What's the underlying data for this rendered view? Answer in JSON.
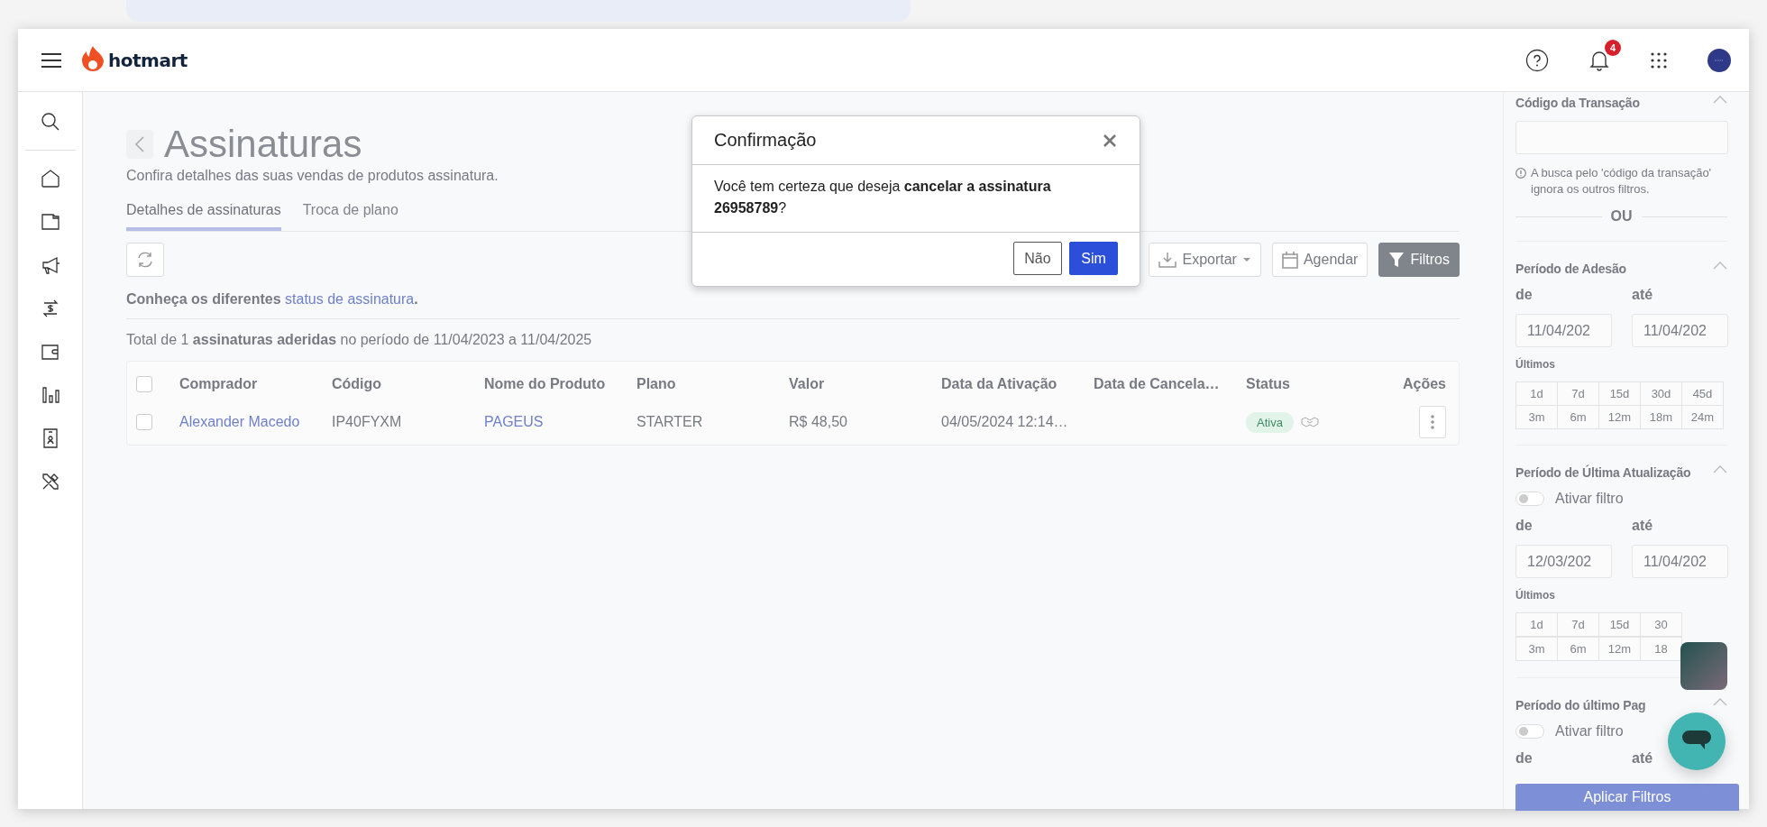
{
  "header": {
    "logo": "hotmart",
    "notification_count": "4"
  },
  "page": {
    "title": "Assinaturas",
    "subtitle": "Confira detalhes das suas vendas de produtos assinatura.",
    "tabs": [
      {
        "label": "Detalhes de assinaturas",
        "selected": true
      },
      {
        "label": "Troca de plano",
        "selected": false
      }
    ]
  },
  "toolbar": {
    "buttons": [
      {
        "label": "Exportar",
        "kind": "dropdown"
      },
      {
        "label": "Agendar",
        "kind": "outline"
      },
      {
        "label": "Filtros",
        "kind": "primary"
      }
    ]
  },
  "status_info": {
    "prefix": "Conheça os diferentes",
    "link": "status de assinatura",
    "suffix": "."
  },
  "summary": "Total de 1 **assinaturas aderidas** no período de 11/04/2023 a 11/04/2025",
  "table": {
    "all_checked": false,
    "columns": [
      "Comprador",
      "Código",
      "Nome do Produto",
      "Plano",
      "Valor",
      "Data da Ativação",
      "Data de Cancela…",
      "Status",
      "Ações"
    ],
    "rows": [
      {
        "checked": false,
        "buyer": "Alexander Macedo",
        "code": "IP40FYXM",
        "product": "PAGEUS",
        "plan": "STARTER",
        "value": "R$ 48,50",
        "activation_date": "04/05/2024 12:14…",
        "status": "Ativa"
      }
    ]
  },
  "modal": {
    "title": "Confirmação",
    "message": "Você tem certeza que deseja **cancelar a assinatura 26958789**?",
    "buttons": [
      {
        "label": "Não",
        "kind": "secondary"
      },
      {
        "label": "Sim",
        "kind": "primary"
      }
    ]
  },
  "filters": {
    "transaction": {
      "title": "Código da Transação",
      "expanded": true,
      "hint": "A busca pelo 'código da transação' ignora os outros filtros.",
      "separator": "OU"
    },
    "sections": [
      {
        "title": "Período de Adesão",
        "expanded": true,
        "from_label": "de",
        "to_label": "até",
        "from": "11/04/202",
        "to": "11/04/202",
        "recent_label": "Últimos",
        "recent": [
          [
            "1d",
            "7d",
            "15d",
            "30d",
            "45d"
          ],
          [
            "3m",
            "6m",
            "12m",
            "18m",
            "24m"
          ]
        ]
      },
      {
        "title": "Período de Última Atualização",
        "expanded": true,
        "toggle": {
          "label": "Ativar filtro",
          "on": false
        },
        "from_label": "de",
        "to_label": "até",
        "from": "12/03/202",
        "to": "11/04/202",
        "recent_label": "Últimos",
        "recent": [
          [
            "1d",
            "7d",
            "15d",
            "30"
          ],
          [
            "3m",
            "6m",
            "12m",
            "18"
          ]
        ]
      },
      {
        "title": "Período do último Pag",
        "expanded": true,
        "toggle": {
          "label": "Ativar filtro",
          "on": false
        },
        "from_label": "de",
        "to_label": "até"
      }
    ],
    "apply_button": "Aplicar Filtros"
  }
}
